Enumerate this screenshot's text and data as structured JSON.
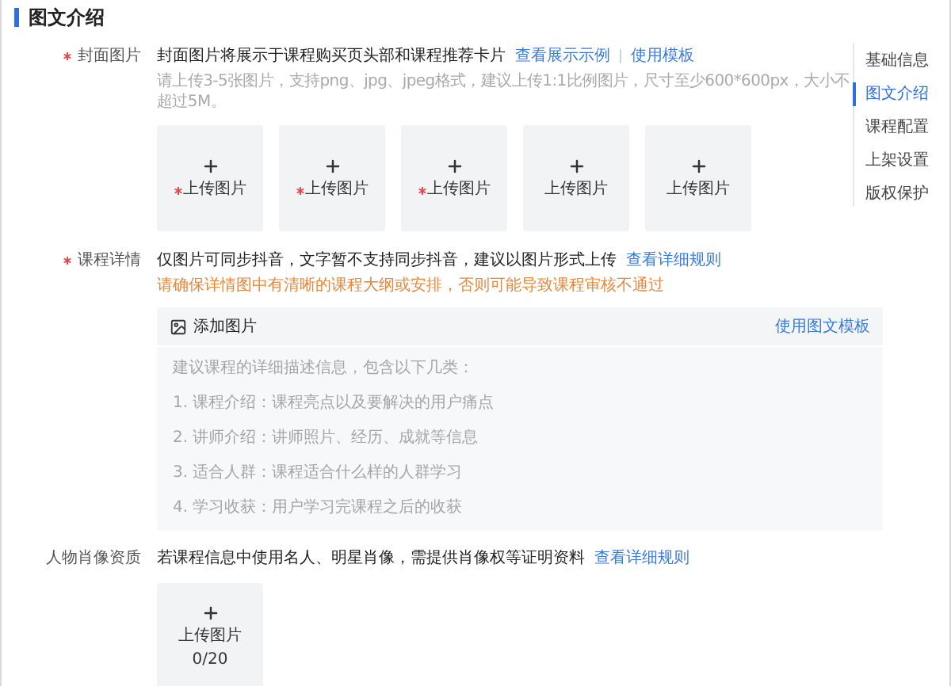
{
  "section_title": "图文介绍",
  "side_nav": [
    {
      "label": "基础信息",
      "selected": false
    },
    {
      "label": "图文介绍",
      "selected": true
    },
    {
      "label": "课程配置",
      "selected": false
    },
    {
      "label": "上架设置",
      "selected": false
    },
    {
      "label": "版权保护",
      "selected": false
    }
  ],
  "cover": {
    "label": "封面图片",
    "required": true,
    "description": "封面图片将展示于课程购买页头部和课程推荐卡片",
    "links": [
      "查看展示示例",
      "使用模板"
    ],
    "hint": "请上传3-5张图片，支持png、jpg、jpeg格式，建议上传1:1比例图片，尺寸至少600*600px，大小不超过5M。",
    "tiles": [
      {
        "label": "上传图片",
        "required": true
      },
      {
        "label": "上传图片",
        "required": true
      },
      {
        "label": "上传图片",
        "required": true
      },
      {
        "label": "上传图片",
        "required": false
      },
      {
        "label": "上传图片",
        "required": false
      }
    ]
  },
  "detail": {
    "label": "课程详情",
    "required": true,
    "description": "仅图片可同步抖音，文字暂不支持同步抖音，建议以图片形式上传",
    "link": "查看详细规则",
    "warning": "请确保详情图中有清晰的课程大纲或安排，否则可能导致课程审核不通过",
    "editor": {
      "add_image": "添加图片",
      "template_link": "使用图文模板",
      "intro": "建议课程的详细描述信息，包含以下几类：",
      "lines": [
        "1. 课程介绍：课程亮点以及要解决的用户痛点",
        "2. 讲师介绍：讲师照片、经历、成就等信息",
        "3. 适合人群：课程适合什么样的人群学习",
        "4. 学习收获：用户学习完课程之后的收获"
      ]
    }
  },
  "portrait": {
    "label": "人物肖像资质",
    "required": false,
    "description": "若课程信息中使用名人、明星肖像，需提供肖像权等证明资料",
    "link": "查看详细规则",
    "tile": {
      "label": "上传图片",
      "count": "0/20"
    }
  }
}
